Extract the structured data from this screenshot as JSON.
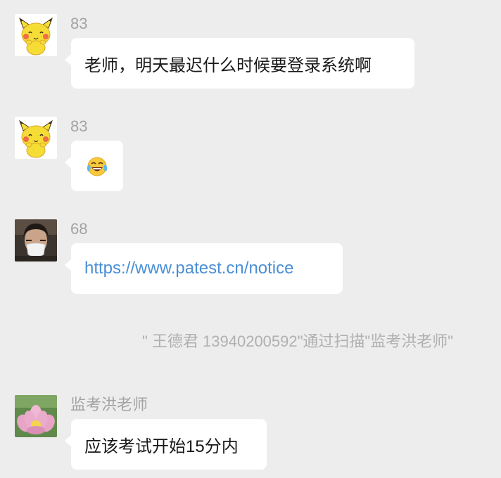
{
  "messages": [
    {
      "sender": "83",
      "text": "老师，明天最迟什么时候要登录系统啊",
      "avatar_icon": "yellow-cartoon-creature-avatar"
    },
    {
      "sender": "83",
      "emoji_icon": "tears-of-joy-emoji",
      "avatar_icon": "yellow-cartoon-creature-avatar"
    },
    {
      "sender": "68",
      "link": "https://www.patest.cn/notice",
      "avatar_icon": "masked-person-photo-avatar"
    },
    {
      "sender": "监考洪老师",
      "text": "应该考试开始15分内",
      "avatar_icon": "pink-flower-photo-avatar"
    }
  ],
  "system_notice": "\" 王德君 13940200592\"通过扫描\"监考洪老师\"",
  "colors": {
    "background": "#ededed",
    "bubble": "#ffffff",
    "sender_name": "#a3a3a3",
    "link": "#4a8fd6",
    "system_text": "#b0b0b0"
  }
}
